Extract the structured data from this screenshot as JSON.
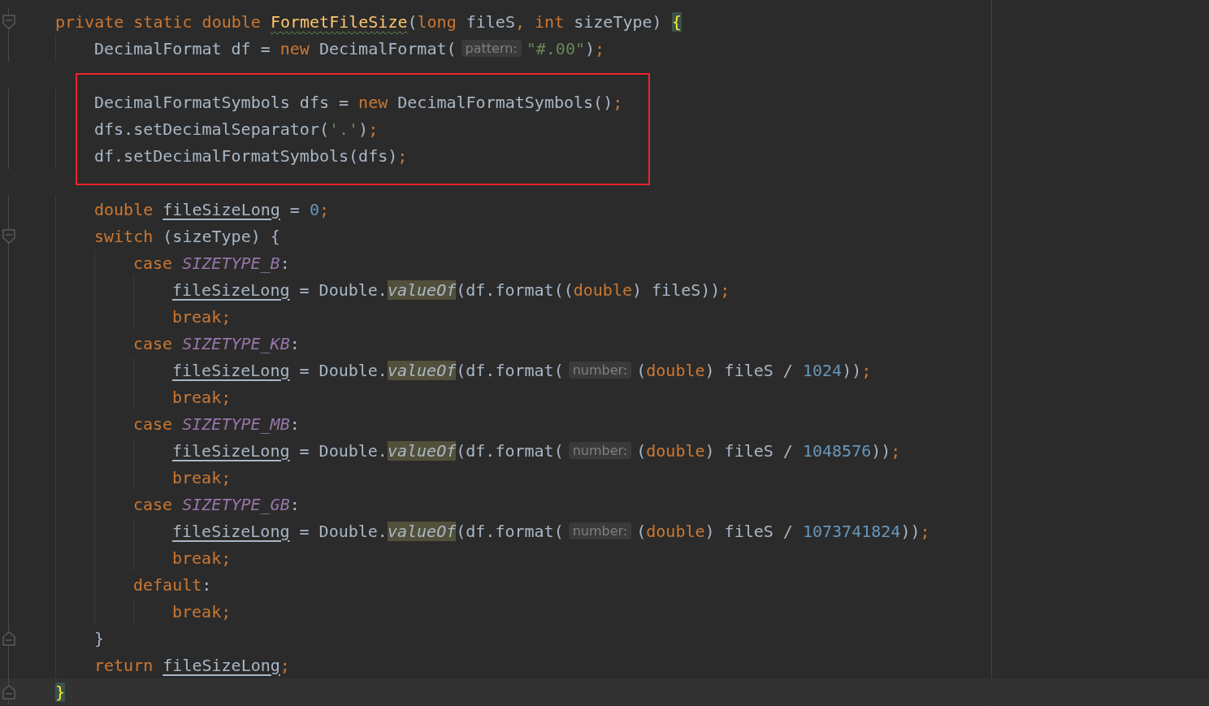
{
  "editor": {
    "blocks": [
      {
        "lines": [
          {
            "fold_start": true,
            "tokens": [
              {
                "kind": "keyword",
                "text": "private static double "
              },
              {
                "kind": "method-decl",
                "text": "FormetFileSize"
              },
              {
                "kind": "plain",
                "text": "("
              },
              {
                "kind": "keyword",
                "text": "long "
              },
              {
                "kind": "plain",
                "text": "fileS"
              },
              {
                "kind": "punct",
                "text": ", "
              },
              {
                "kind": "keyword",
                "text": "int "
              },
              {
                "kind": "plain",
                "text": "sizeType) "
              },
              {
                "kind": "brace-match",
                "text": "{"
              }
            ]
          },
          {
            "tokens": [
              {
                "kind": "plain",
                "text": "    DecimalFormat df = "
              },
              {
                "kind": "keyword",
                "text": "new "
              },
              {
                "kind": "plain",
                "text": "DecimalFormat("
              },
              {
                "kind": "hint",
                "text": "pattern:"
              },
              {
                "kind": "string",
                "text": "\"#.00\""
              },
              {
                "kind": "plain",
                "text": ")"
              },
              {
                "kind": "punct",
                "text": ";"
              }
            ]
          }
        ]
      },
      {
        "boxed": true,
        "lines": [
          {
            "tokens": [
              {
                "kind": "plain",
                "text": "    DecimalFormatSymbols dfs = "
              },
              {
                "kind": "keyword",
                "text": "new "
              },
              {
                "kind": "plain",
                "text": "DecimalFormatSymbols()"
              },
              {
                "kind": "punct",
                "text": ";"
              }
            ]
          },
          {
            "tokens": [
              {
                "kind": "plain",
                "text": "    dfs.setDecimalSeparator("
              },
              {
                "kind": "string",
                "text": "'.'"
              },
              {
                "kind": "plain",
                "text": ")"
              },
              {
                "kind": "punct",
                "text": ";"
              }
            ]
          },
          {
            "tokens": [
              {
                "kind": "plain",
                "text": "    df.setDecimalFormatSymbols(dfs)"
              },
              {
                "kind": "punct",
                "text": ";"
              }
            ]
          }
        ]
      },
      {
        "lines": [
          {
            "tokens": [
              {
                "kind": "keyword",
                "text": "    double "
              },
              {
                "kind": "field",
                "text": "fileSizeLong"
              },
              {
                "kind": "plain",
                "text": " = "
              },
              {
                "kind": "number",
                "text": "0"
              },
              {
                "kind": "punct",
                "text": ";"
              }
            ]
          },
          {
            "fold_start": true,
            "tokens": [
              {
                "kind": "keyword",
                "text": "    switch "
              },
              {
                "kind": "plain",
                "text": "(sizeType) {"
              }
            ]
          },
          {
            "tokens": [
              {
                "kind": "keyword",
                "text": "        case "
              },
              {
                "kind": "constant",
                "text": "SIZETYPE_B"
              },
              {
                "kind": "plain",
                "text": ":"
              }
            ]
          },
          {
            "tokens": [
              {
                "kind": "field",
                "text": "            fileSizeLong"
              },
              {
                "kind": "plain",
                "text": " = Double."
              },
              {
                "kind": "static-call",
                "text": "valueOf"
              },
              {
                "kind": "plain",
                "text": "(df.format(("
              },
              {
                "kind": "keyword",
                "text": "double"
              },
              {
                "kind": "plain",
                "text": ") fileS))"
              },
              {
                "kind": "punct",
                "text": ";"
              }
            ]
          },
          {
            "tokens": [
              {
                "kind": "keyword",
                "text": "            break"
              },
              {
                "kind": "punct",
                "text": ";"
              }
            ]
          },
          {
            "tokens": [
              {
                "kind": "keyword",
                "text": "        case "
              },
              {
                "kind": "constant",
                "text": "SIZETYPE_KB"
              },
              {
                "kind": "plain",
                "text": ":"
              }
            ]
          },
          {
            "tokens": [
              {
                "kind": "field",
                "text": "            fileSizeLong"
              },
              {
                "kind": "plain",
                "text": " = Double."
              },
              {
                "kind": "static-call",
                "text": "valueOf"
              },
              {
                "kind": "plain",
                "text": "(df.format("
              },
              {
                "kind": "hint",
                "text": "number:"
              },
              {
                "kind": "plain",
                "text": "("
              },
              {
                "kind": "keyword",
                "text": "double"
              },
              {
                "kind": "plain",
                "text": ") fileS / "
              },
              {
                "kind": "number",
                "text": "1024"
              },
              {
                "kind": "plain",
                "text": "))"
              },
              {
                "kind": "punct",
                "text": ";"
              }
            ]
          },
          {
            "tokens": [
              {
                "kind": "keyword",
                "text": "            break"
              },
              {
                "kind": "punct",
                "text": ";"
              }
            ]
          },
          {
            "tokens": [
              {
                "kind": "keyword",
                "text": "        case "
              },
              {
                "kind": "constant",
                "text": "SIZETYPE_MB"
              },
              {
                "kind": "plain",
                "text": ":"
              }
            ]
          },
          {
            "tokens": [
              {
                "kind": "field",
                "text": "            fileSizeLong"
              },
              {
                "kind": "plain",
                "text": " = Double."
              },
              {
                "kind": "static-call",
                "text": "valueOf"
              },
              {
                "kind": "plain",
                "text": "(df.format("
              },
              {
                "kind": "hint",
                "text": "number:"
              },
              {
                "kind": "plain",
                "text": "("
              },
              {
                "kind": "keyword",
                "text": "double"
              },
              {
                "kind": "plain",
                "text": ") fileS / "
              },
              {
                "kind": "number",
                "text": "1048576"
              },
              {
                "kind": "plain",
                "text": "))"
              },
              {
                "kind": "punct",
                "text": ";"
              }
            ]
          },
          {
            "tokens": [
              {
                "kind": "keyword",
                "text": "            break"
              },
              {
                "kind": "punct",
                "text": ";"
              }
            ]
          },
          {
            "tokens": [
              {
                "kind": "keyword",
                "text": "        case "
              },
              {
                "kind": "constant",
                "text": "SIZETYPE_GB"
              },
              {
                "kind": "plain",
                "text": ":"
              }
            ]
          },
          {
            "tokens": [
              {
                "kind": "field",
                "text": "            fileSizeLong"
              },
              {
                "kind": "plain",
                "text": " = Double."
              },
              {
                "kind": "static-call",
                "text": "valueOf"
              },
              {
                "kind": "plain",
                "text": "(df.format("
              },
              {
                "kind": "hint",
                "text": "number:"
              },
              {
                "kind": "plain",
                "text": "("
              },
              {
                "kind": "keyword",
                "text": "double"
              },
              {
                "kind": "plain",
                "text": ") fileS / "
              },
              {
                "kind": "number",
                "text": "1073741824"
              },
              {
                "kind": "plain",
                "text": "))"
              },
              {
                "kind": "punct",
                "text": ";"
              }
            ]
          },
          {
            "tokens": [
              {
                "kind": "keyword",
                "text": "            break"
              },
              {
                "kind": "punct",
                "text": ";"
              }
            ]
          },
          {
            "tokens": [
              {
                "kind": "keyword",
                "text": "        default"
              },
              {
                "kind": "plain",
                "text": ":"
              }
            ]
          },
          {
            "tokens": [
              {
                "kind": "keyword",
                "text": "            break"
              },
              {
                "kind": "punct",
                "text": ";"
              }
            ]
          },
          {
            "fold_end": true,
            "tokens": [
              {
                "kind": "plain",
                "text": "    }"
              }
            ]
          },
          {
            "tokens": [
              {
                "kind": "keyword",
                "text": "    return "
              },
              {
                "kind": "field",
                "text": "fileSizeLong"
              },
              {
                "kind": "punct",
                "text": ";"
              }
            ]
          },
          {
            "fold_end": true,
            "current": true,
            "tokens": [
              {
                "kind": "brace-match",
                "text": "}"
              }
            ]
          }
        ]
      }
    ]
  }
}
